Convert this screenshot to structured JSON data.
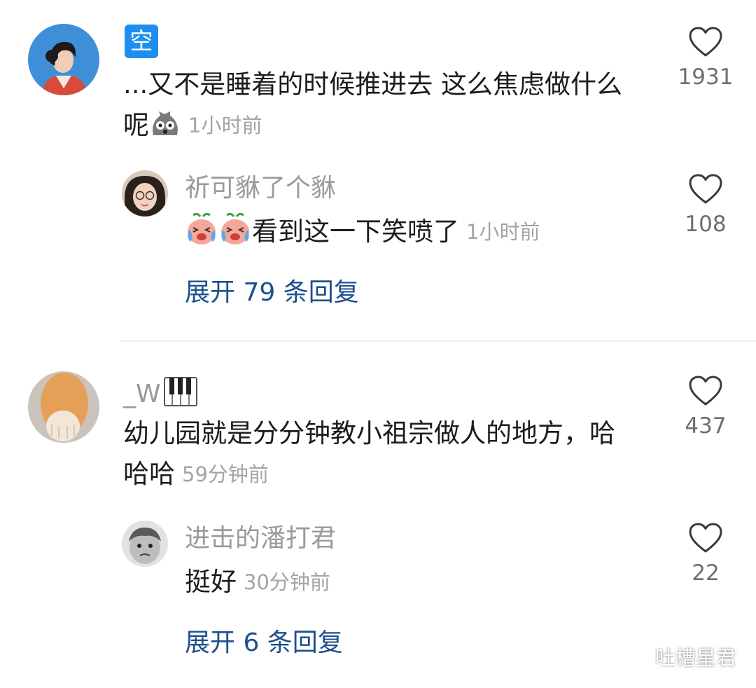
{
  "comments": [
    {
      "username": "空",
      "text_line1": "...又不是睡着的时候推进去 这么焦虑做什么",
      "text_line2": "呢",
      "time": "1小时前",
      "likes": "1931",
      "reply": {
        "username": "祈可貅了个貅",
        "text": "看到这一下笑喷了",
        "time": "1小时前",
        "likes": "108"
      },
      "expand_label": "展开 79 条回复"
    },
    {
      "username": "_W",
      "text_line1": "幼儿园就是分分钟教小祖宗做人的地方，哈",
      "text_line2": "哈哈",
      "time": "59分钟前",
      "likes": "437",
      "reply": {
        "username": "进击的潘打君",
        "text": "挺好",
        "time": "30分钟前",
        "likes": "22"
      },
      "expand_label": "展开 6 条回复"
    }
  ],
  "watermark": "吐槽星君",
  "colors": {
    "link": "#1d4f8e",
    "username": "#9a9a9a",
    "text": "#1c1c1c",
    "badge": "#1e8ff0"
  }
}
